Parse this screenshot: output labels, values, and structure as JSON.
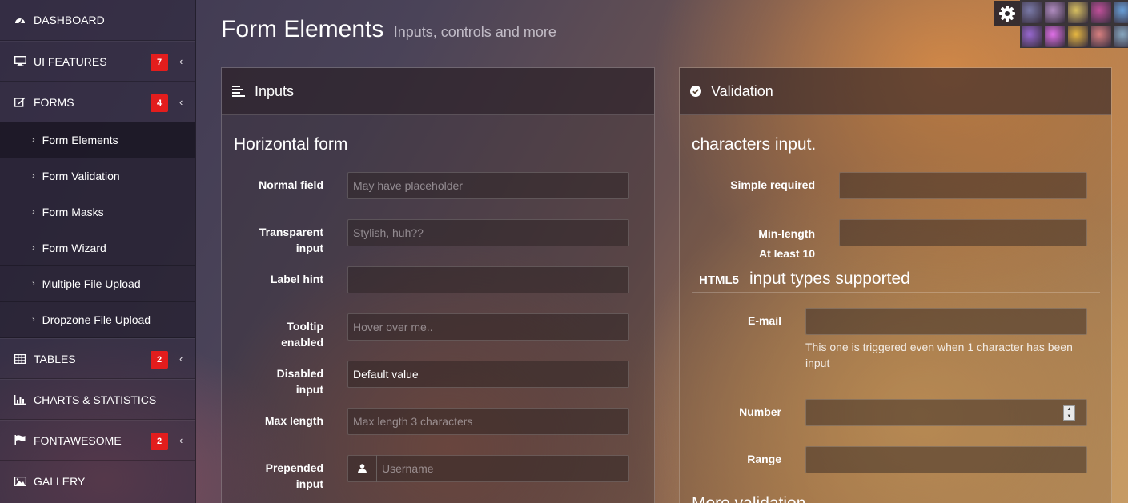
{
  "sidebar": {
    "items": [
      {
        "label": "DASHBOARD",
        "icon": "dashboard-icon"
      },
      {
        "label": "UI FEATURES",
        "icon": "monitor-icon",
        "badge": "7"
      },
      {
        "label": "FORMS",
        "icon": "edit-icon",
        "badge": "4"
      },
      {
        "label": "TABLES",
        "icon": "table-icon",
        "badge": "2"
      },
      {
        "label": "CHARTS & STATISTICS",
        "icon": "bar-chart-icon"
      },
      {
        "label": "FONTAWESOME",
        "icon": "flag-icon",
        "badge": "2"
      },
      {
        "label": "GALLERY",
        "icon": "picture-icon"
      }
    ],
    "forms_subitems": [
      {
        "label": "Form Elements",
        "active": true
      },
      {
        "label": "Form Validation"
      },
      {
        "label": "Form Masks"
      },
      {
        "label": "Form Wizard"
      },
      {
        "label": "Multiple File Upload"
      },
      {
        "label": "Dropzone File Upload"
      }
    ]
  },
  "header": {
    "title": "Form Elements",
    "subtitle": "Inputs, controls and more"
  },
  "theme_swatches": [
    "#7a7aa8",
    "#b08cc0",
    "#d8c060",
    "#c0509a",
    "#6aa0d8",
    "#9868d0",
    "#e070e8",
    "#e8b840",
    "#d88080",
    "#88a8c0"
  ],
  "inputs_panel": {
    "title": "Inputs",
    "legend": "Horizontal form",
    "fields": {
      "normal": {
        "label": "Normal field",
        "placeholder": "May have placeholder"
      },
      "transparent": {
        "label1": "Transparent",
        "label2": "input",
        "placeholder": "Stylish, huh??"
      },
      "hint": {
        "label": "Label hint"
      },
      "tooltip": {
        "label1": "Tooltip",
        "label2": "enabled",
        "placeholder": "Hover over me.."
      },
      "disabled": {
        "label1": "Disabled",
        "label2": "input",
        "value": "Default value"
      },
      "maxlength": {
        "label": "Max length",
        "placeholder": "Max length 3 characters"
      },
      "prepended": {
        "label1": "Prepended",
        "label2": "input",
        "placeholder": "Username"
      }
    }
  },
  "validation_panel": {
    "title": "Validation",
    "legend": "characters input.",
    "fields": {
      "required": {
        "label": "Simple required"
      },
      "minlength": {
        "label1": "Min-length",
        "label2": "At least 10"
      },
      "html5_badge": "HTML5",
      "html5_legend": "input types supported",
      "email": {
        "label": "E-mail",
        "hint": "This one is triggered even when 1 character has been input"
      },
      "number": {
        "label": "Number"
      },
      "range": {
        "label": "Range"
      },
      "more_legend": "More validation"
    }
  }
}
